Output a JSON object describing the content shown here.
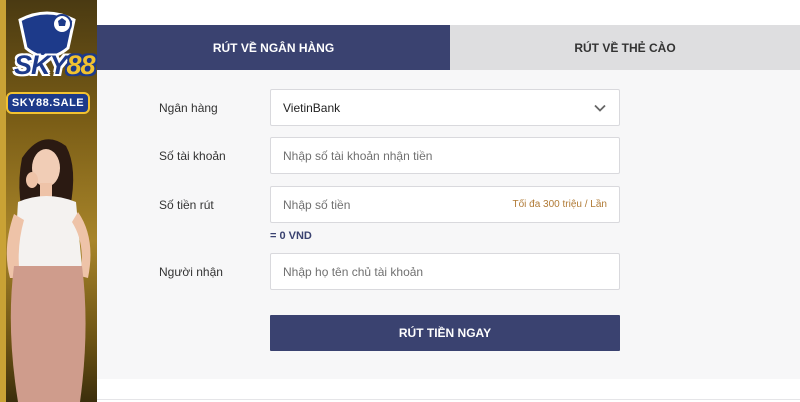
{
  "banner": {
    "logo_text": "SKY",
    "logo_number": "88",
    "domain": "SKY88.SALE",
    "colors": {
      "brand_blue": "#1d3a8a",
      "brand_gold": "#f2c230"
    }
  },
  "tabs": [
    {
      "label": "RÚT VỀ NGÂN HÀNG",
      "active": true
    },
    {
      "label": "RÚT VỀ THẺ CÀO",
      "active": false
    }
  ],
  "form": {
    "bank": {
      "label": "Ngân hàng",
      "value": "VietinBank"
    },
    "account": {
      "label": "Số tài khoản",
      "placeholder": "Nhập số tài khoản nhận tiền"
    },
    "amount": {
      "label": "Số tiền rút",
      "placeholder": "Nhập số tiền",
      "hint": "Tối đa 300 triệu / Lần",
      "converted": "= 0 VND"
    },
    "recipient": {
      "label": "Người nhận",
      "placeholder": "Nhập họ tên chủ tài khoản"
    },
    "submit_label": "RÚT TIỀN NGAY"
  },
  "colors": {
    "primary": "#3a4270",
    "tab_inactive": "#dedee0",
    "hint": "#b07a35"
  }
}
